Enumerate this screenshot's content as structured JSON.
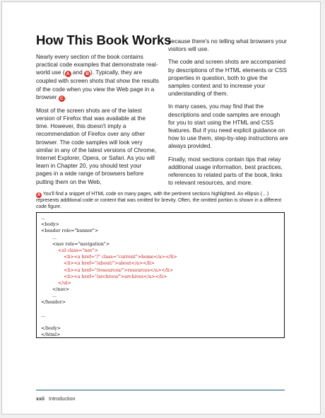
{
  "heading": "How This Book Works",
  "left_column": {
    "p1_before": "Nearly every section of the book contains practical code examples that demonstrate real-world use (",
    "p1_badge_a": "A",
    "p1_and": " and ",
    "p1_badge_b": "B",
    "p1_mid": "). Typically, they are coupled with screen shots that show the results of the code when you view the Web page in a browser ",
    "p1_badge_c": "C",
    "p1_end": ".",
    "p2": "Most of the screen shots are of the latest version of Firefox that was available at the time. However, this doesn't imply a recommendation of Firefox over any other browser. The code samples will look very similar in any of the latest versions of Chrome, Internet Explorer, Opera, or Safari. As you will learn in Chapter 20, you should test your pages in a wide range of browsers before putting them on the Web,"
  },
  "right_column": {
    "p1": "because there's no telling what browsers your visitors will use.",
    "p2": "The code and screen shots are accompanied by descriptions of the HTML elements or CSS properties in question, both to give the samples context and to increase your understanding of them.",
    "p3": "In many cases, you may find that the descriptions and code samples are enough for you to start using the HTML and CSS features. But if you need explicit guidance on how to use them, step-by-step instructions are always provided.",
    "p4": "Finally, most sections contain tips that relay additional usage information, best practices, references to related parts of the book, links to relevant resources, and more."
  },
  "caption": {
    "badge": "A",
    "text": " You'll find a snippet of HTML code on many pages, with the pertinent sections highlighted. An ellipsis (…) represents additional code or content that was omitted for brevity. Often, the omitted portion is shown in a different code figure."
  },
  "code_lines": [
    {
      "text": "...",
      "hl": false
    },
    {
      "text": "<body>",
      "hl": false
    },
    {
      "text": "<header role=\"banner\">",
      "hl": false
    },
    {
      "text": "        ...",
      "hl": false
    },
    {
      "text": "        <nav role=\"navigation\">",
      "hl": false
    },
    {
      "text": "            <ul class=\"nav\">",
      "hl": true
    },
    {
      "text": "                <li><a href=\"/\" class=\"current\">home</a></li>",
      "hl": true
    },
    {
      "text": "                <li><a href=\"/about/\">about</a></li>",
      "hl": true
    },
    {
      "text": "                <li><a href=\"/resources/\">resources</a></li>",
      "hl": true
    },
    {
      "text": "                <li><a href=\"/archives/\">archives</a></li>",
      "hl": true
    },
    {
      "text": "            </ul>",
      "hl": true
    },
    {
      "text": "        </nav>",
      "hl": false
    },
    {
      "text": "        ...",
      "hl": false
    },
    {
      "text": "</header>",
      "hl": false
    },
    {
      "text": "",
      "hl": false
    },
    {
      "text": "...",
      "hl": false
    },
    {
      "text": "",
      "hl": false
    },
    {
      "text": "</body>",
      "hl": false
    },
    {
      "text": "</html>",
      "hl": false
    }
  ],
  "footer": {
    "page_number": "xxii",
    "section": "Introduction"
  },
  "colors": {
    "badge": "#d9332a",
    "code_highlight": "#c8201e",
    "footer_rule": "#1f5a7a"
  }
}
